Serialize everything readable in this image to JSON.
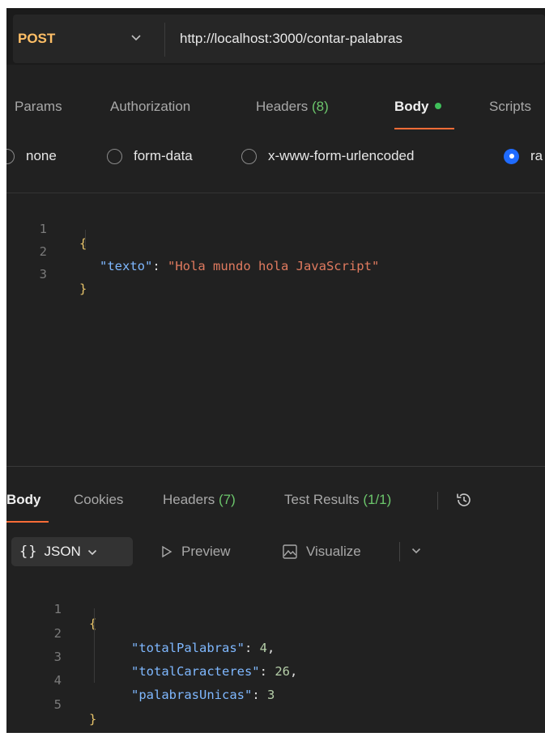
{
  "request": {
    "method": "POST",
    "url": "http://localhost:3000/contar-palabras",
    "tabs": [
      {
        "label": "Params"
      },
      {
        "label": "Authorization"
      },
      {
        "label": "Headers",
        "count": "(8)"
      },
      {
        "label": "Body"
      },
      {
        "label": "Scripts"
      }
    ],
    "body_types": [
      "none",
      "form-data",
      "x-www-form-urlencoded",
      "ra"
    ],
    "selected_body_type": "raw",
    "editor": {
      "line_numbers": [
        "1",
        "2",
        "3"
      ],
      "open_brace": "{",
      "close_brace": "}",
      "key": "\"texto\"",
      "colon": ": ",
      "value": "\"Hola mundo hola JavaScript\""
    }
  },
  "response": {
    "tabs": [
      {
        "label": "Body"
      },
      {
        "label": "Cookies"
      },
      {
        "label": "Headers",
        "count": "(7)"
      },
      {
        "label": "Test Results",
        "count": "(1/1)"
      }
    ],
    "history_icon": "history-icon",
    "toolbar": {
      "format_label": "JSON",
      "format_icon": "{}",
      "preview_label": "Preview",
      "visualize_label": "Visualize"
    },
    "editor": {
      "line_numbers": [
        "1",
        "2",
        "3",
        "4",
        "5"
      ],
      "open_brace": "{",
      "close_brace": "}",
      "lines": [
        {
          "key": "\"totalPalabras\"",
          "value": "4",
          "trail": ","
        },
        {
          "key": "\"totalCaracteres\"",
          "value": "26",
          "trail": ","
        },
        {
          "key": "\"palabrasUnicas\"",
          "value": "3",
          "trail": ""
        }
      ]
    }
  },
  "colors": {
    "method": "#ffbf66",
    "accent": "#ff6c37",
    "radio_selected": "#1f6bff",
    "count_green": "#6cc66c",
    "json_key": "#7fb8ff",
    "json_string": "#e07a5f"
  }
}
